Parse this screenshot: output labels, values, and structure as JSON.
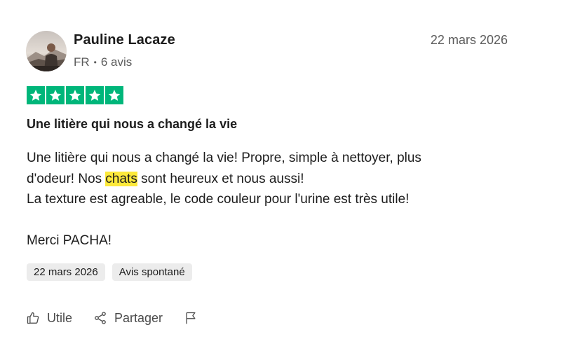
{
  "author": {
    "name": "Pauline Lacaze",
    "country": "FR",
    "review_count": "6 avis",
    "avatar": "avatar-photo"
  },
  "review": {
    "date": "22 mars 2026",
    "rating": 5,
    "rating_color": "#00b67a",
    "title": "Une litière qui nous a changé la vie",
    "body": {
      "line1": "Une litière qui nous a changé la vie! Propre, simple à nettoyer, plus",
      "line2_before": "d'odeur! Nos ",
      "line2_highlight": "chats",
      "line2_after": " sont heureux et nous aussi!",
      "line3": "La texture est agreable, le code couleur pour l'urine est très utile!",
      "line5": "Merci PACHA!"
    },
    "highlight_color": "#fde93b"
  },
  "tags": {
    "date": "22 mars 2026",
    "type": "Avis spontané"
  },
  "actions": {
    "useful_label": "Utile",
    "useful_icon": "thumbs-up-icon",
    "share_label": "Partager",
    "share_icon": "share-icon",
    "report_icon": "flag-icon"
  }
}
